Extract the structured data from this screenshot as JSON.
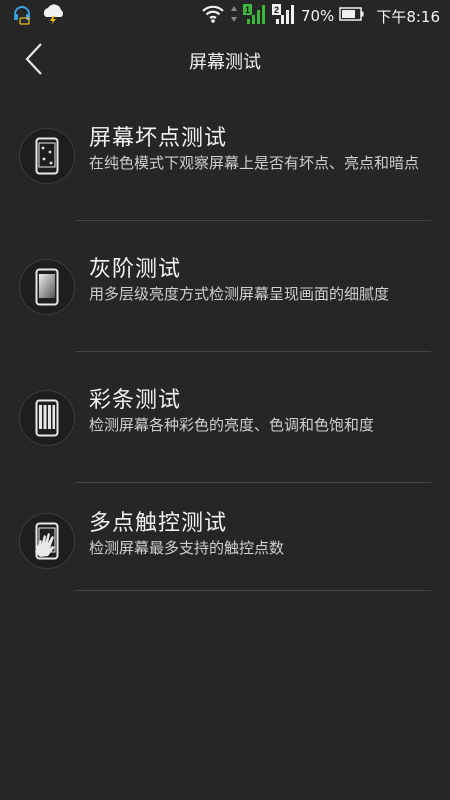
{
  "status_bar": {
    "battery_percent": "70%",
    "time": "下午8:16",
    "sim1": "1",
    "sim2": "2"
  },
  "header": {
    "title": "屏幕测试"
  },
  "items": [
    {
      "title": "屏幕坏点测试",
      "desc": "在纯色模式下观察屏幕上是否有坏点、亮点和暗点",
      "icon": "dead-pixel-phone-icon"
    },
    {
      "title": "灰阶测试",
      "desc": "用多层级亮度方式检测屏幕呈现画面的细腻度",
      "icon": "grayscale-phone-icon"
    },
    {
      "title": "彩条测试",
      "desc": "检测屏幕各种彩色的亮度、色调和色饱和度",
      "icon": "color-bars-phone-icon"
    },
    {
      "title": "多点触控测试",
      "desc": "检测屏幕最多支持的触控点数",
      "icon": "multitouch-phone-icon"
    }
  ]
}
